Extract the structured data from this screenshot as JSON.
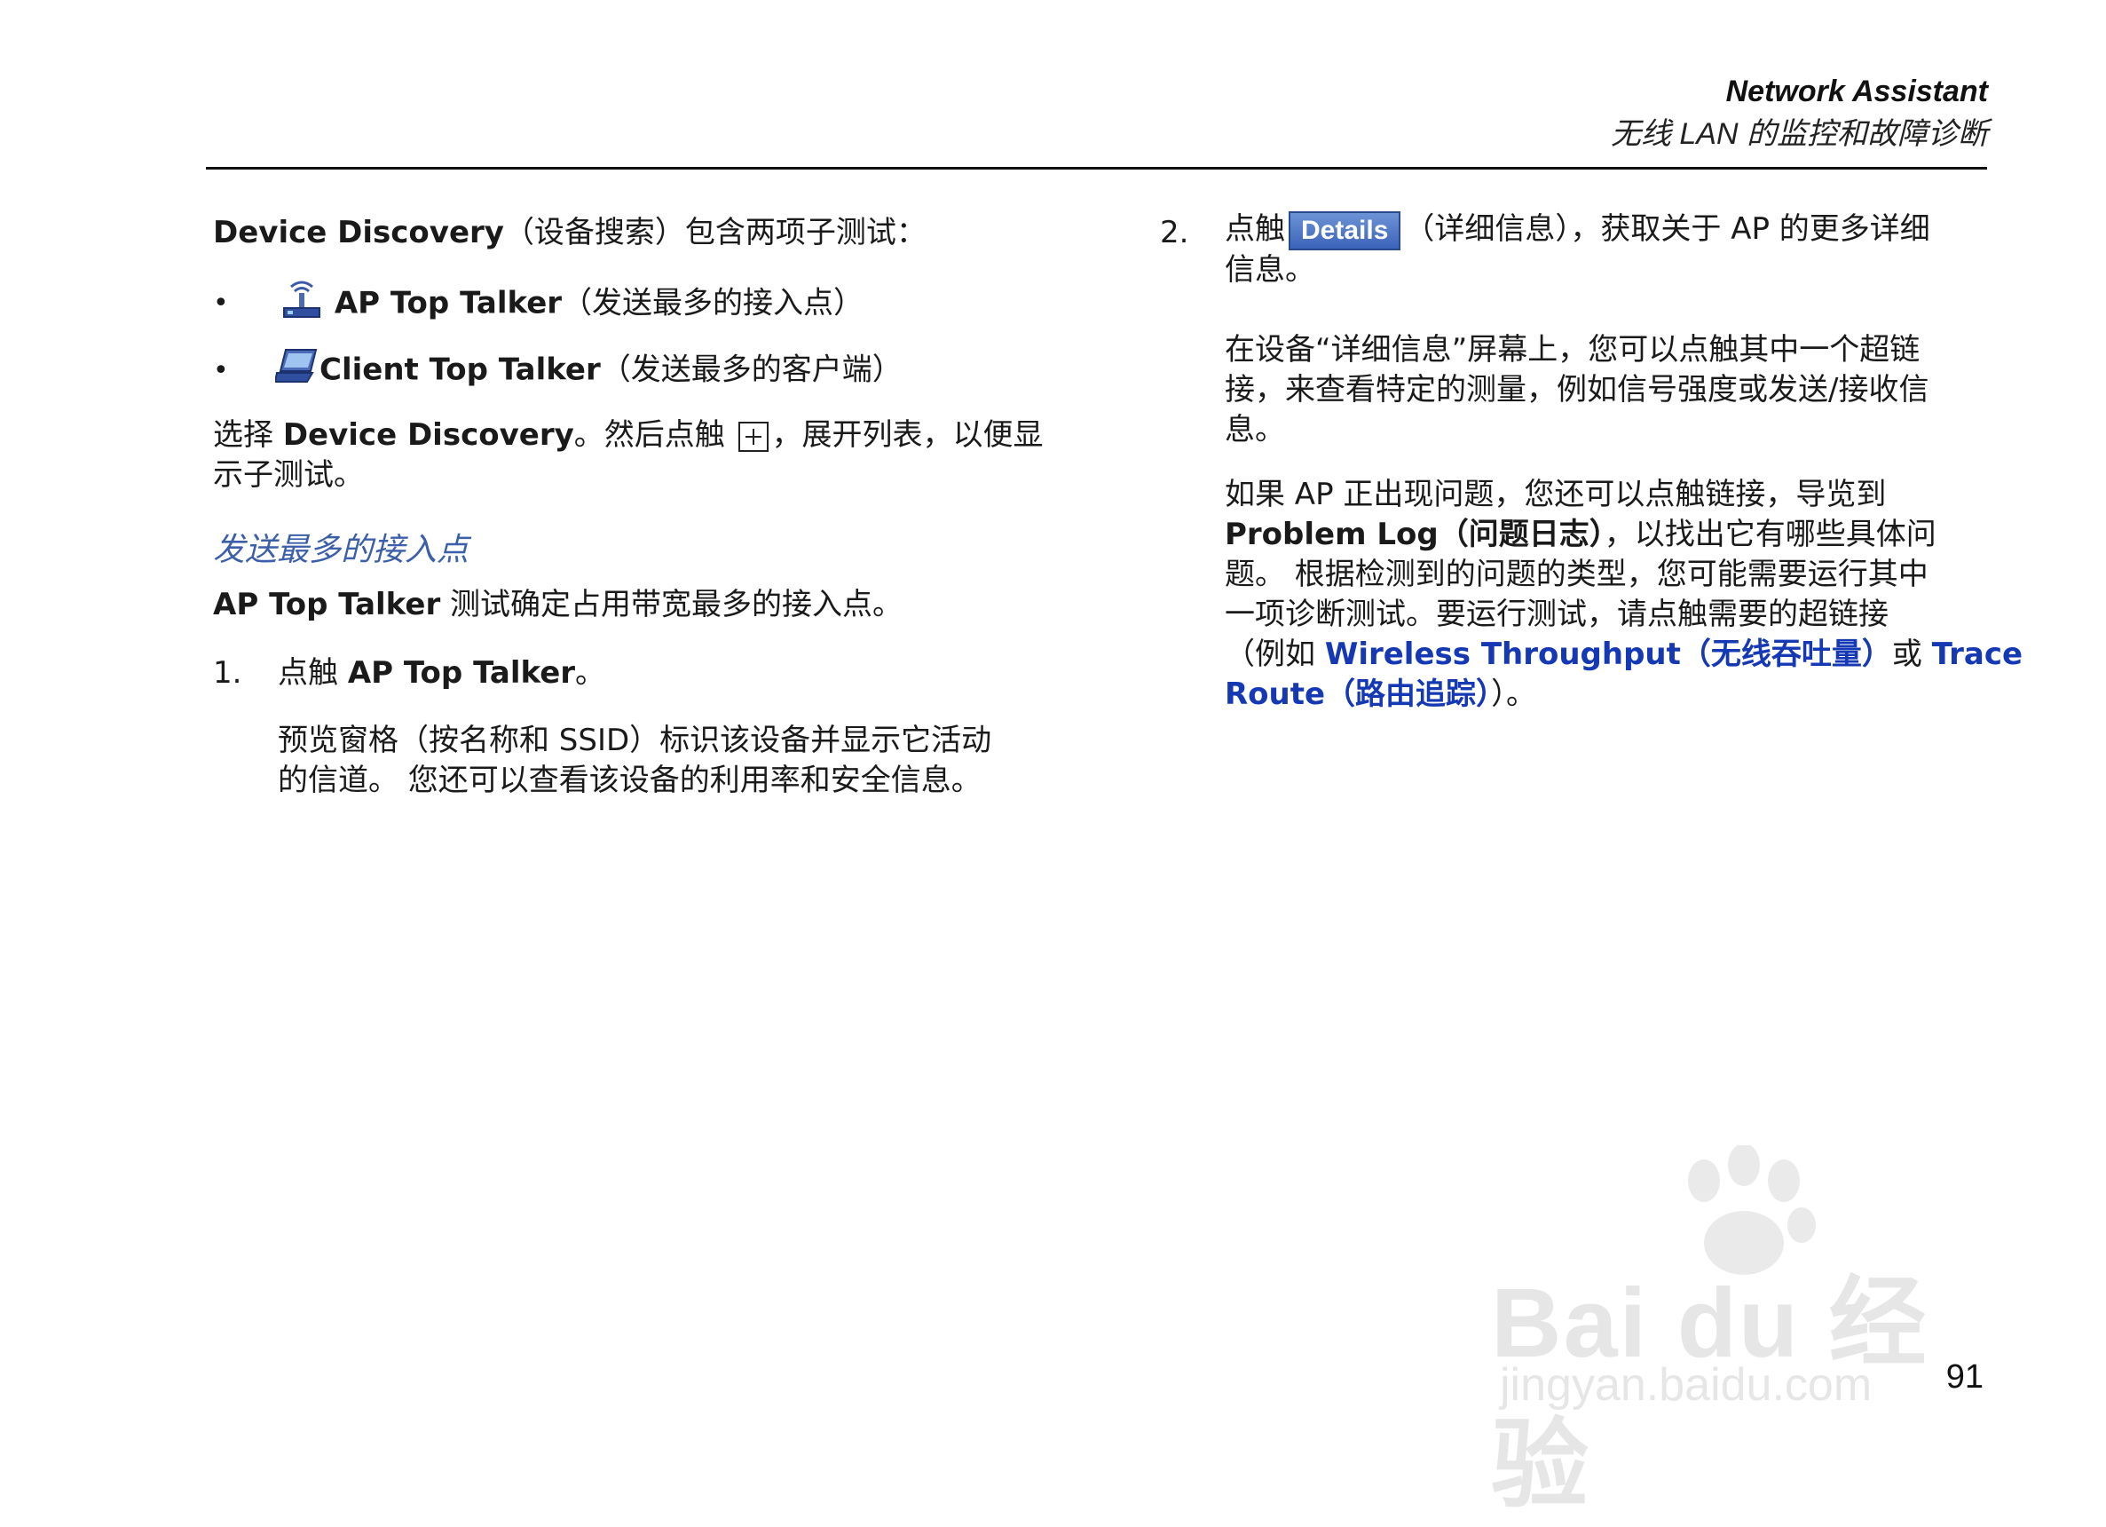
{
  "header": {
    "title": "Network Assistant",
    "subtitle": "无线 LAN 的监控和故障诊断"
  },
  "left": {
    "intro_bold": "Device Discovery",
    "intro_rest": "（设备搜索）包含两项子测试：",
    "bullets": [
      {
        "icon": "ap-tower-icon",
        "bold": "AP Top Talker",
        "rest": "（发送最多的接入点）"
      },
      {
        "icon": "client-laptop-icon",
        "bold": "Client Top Talker",
        "rest": "（发送最多的客户端）"
      }
    ],
    "bullet_char": "•",
    "select_pre": "选择 ",
    "select_bold": "Device Discovery",
    "select_mid": "。然后点触 ",
    "select_post": "，展开列表，以便显",
    "select_line2": "示子测试。",
    "section_heading": "发送最多的接入点",
    "test_bold": "AP Top Talker",
    "test_rest": " 测试确定占用带宽最多的接入点。",
    "step1_num": "1.",
    "step1_pre": "点触 ",
    "step1_bold": "AP Top Talker",
    "step1_post": "。",
    "step1_desc_line1": "预览窗格（按名称和 SSID）标识该设备并显示它活动",
    "step1_desc_line2": "的信道。 您还可以查看该设备的利用率和安全信息。"
  },
  "right": {
    "step2_num": "2.",
    "step2_pre": "点触",
    "details_button": "Details",
    "step2_post": "（详细信息），获取关于 AP 的更多详细",
    "step2_line2": "信息。",
    "para1_line1": "在设备“详细信息”屏幕上，您可以点触其中一个超链",
    "para1_line2": "接，来查看特定的测量，例如信号强度或发送/接收信",
    "para1_line3": "息。",
    "para2_line1": "如果 AP 正出现问题，您还可以点触链接，导览到",
    "para2_bold": "Problem Log",
    "para2_bold_cn": "（问题日志）",
    "para2_line2_rest": "，以找出它有哪些具体问",
    "para2_line3": "题。 根据检测到的问题的类型，您可能需要运行其中",
    "para2_line4": "一项诊断测试。要运行测试，请点触需要的超链接",
    "para2_line5_pre": "（例如 ",
    "link1": "Wireless Throughput",
    "link1_cn": "（无线吞吐量）",
    "para2_or": "或 ",
    "link2_part1": "Trace",
    "link2_part2": "Route",
    "link2_cn": "（路由追踪）",
    "para2_end": "）。"
  },
  "watermark": {
    "logo": "Bai du 经验",
    "url": "jingyan.baidu.com"
  },
  "page_number": "91",
  "colors": {
    "link": "#1538b4",
    "heading_italic": "#3b5fa8",
    "details_button_bg": "#3b63b8"
  }
}
